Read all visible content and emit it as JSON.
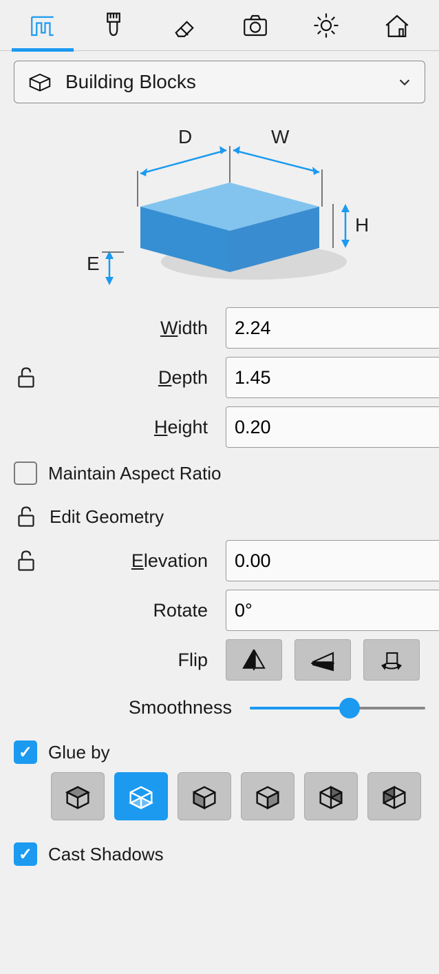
{
  "tabs": {
    "active_index": 0,
    "items": [
      "dimensions-icon",
      "brush-icon",
      "eraser-icon",
      "camera-icon",
      "sun-icon",
      "house-icon"
    ]
  },
  "dropdown": {
    "label": "Building Blocks"
  },
  "diagram": {
    "labels": {
      "d": "D",
      "w": "W",
      "h": "H",
      "e": "E"
    }
  },
  "dimensions": {
    "width": {
      "label": "Width",
      "value": "2.24",
      "underline": "W"
    },
    "depth": {
      "label": "Depth",
      "value": "1.45",
      "underline": "D"
    },
    "height": {
      "label": "Height",
      "value": "0.20",
      "underline": "H"
    }
  },
  "maintain_aspect": {
    "label": "Maintain Aspect Ratio",
    "checked": false
  },
  "edit_geometry": {
    "label": "Edit Geometry"
  },
  "elevation": {
    "label": "Elevation",
    "value": "0.00",
    "underline": "E"
  },
  "rotate": {
    "label": "Rotate",
    "value": "0°"
  },
  "flip": {
    "label": "Flip"
  },
  "smoothness": {
    "label": "Smoothness",
    "value_pct": 57
  },
  "glue_by": {
    "label": "Glue by",
    "checked": true,
    "selected_index": 1
  },
  "cast_shadows": {
    "label": "Cast Shadows",
    "checked": true
  }
}
